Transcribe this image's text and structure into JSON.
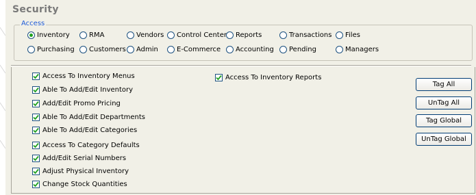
{
  "window": {
    "title": "Security"
  },
  "access": {
    "legend": "Access",
    "selected": "Inventory",
    "options": [
      "Inventory",
      "RMA",
      "Vendors",
      "Control Center",
      "Reports",
      "Transactions",
      "Files",
      "Purchasing",
      "Customers",
      "Admin",
      "E-Commerce",
      "Accounting",
      "Pending",
      "Managers"
    ]
  },
  "permissions": [
    {
      "label": "Access To Inventory Menus",
      "checked": true
    },
    {
      "label": "Able To Add/Edit Inventory",
      "checked": true
    },
    {
      "label": "Add/Edit Promo Pricing",
      "checked": true
    },
    {
      "label": "Able To Add/Edit Departments",
      "checked": true
    },
    {
      "label": "Able To Add/Edit Categories",
      "checked": true
    },
    {
      "label": "Access To Category Defaults",
      "checked": true
    },
    {
      "label": "Add/Edit Serial Numbers",
      "checked": true
    },
    {
      "label": "Adjust Physical Inventory",
      "checked": true
    },
    {
      "label": "Change Stock Quantities",
      "checked": true
    },
    {
      "label": "Access To Inventory Reports",
      "checked": true
    }
  ],
  "buttons": {
    "tag_all": "Tag All",
    "untag_all": "UnTag All",
    "tag_global": "Tag Global",
    "untag_global": "UnTag Global"
  },
  "colors": {
    "panel_bg": "#f1f0e7",
    "legend": "#1f5bd8",
    "radio_dot": "#21a121",
    "check_tick": "#21a121",
    "control_border": "#1c5180"
  }
}
